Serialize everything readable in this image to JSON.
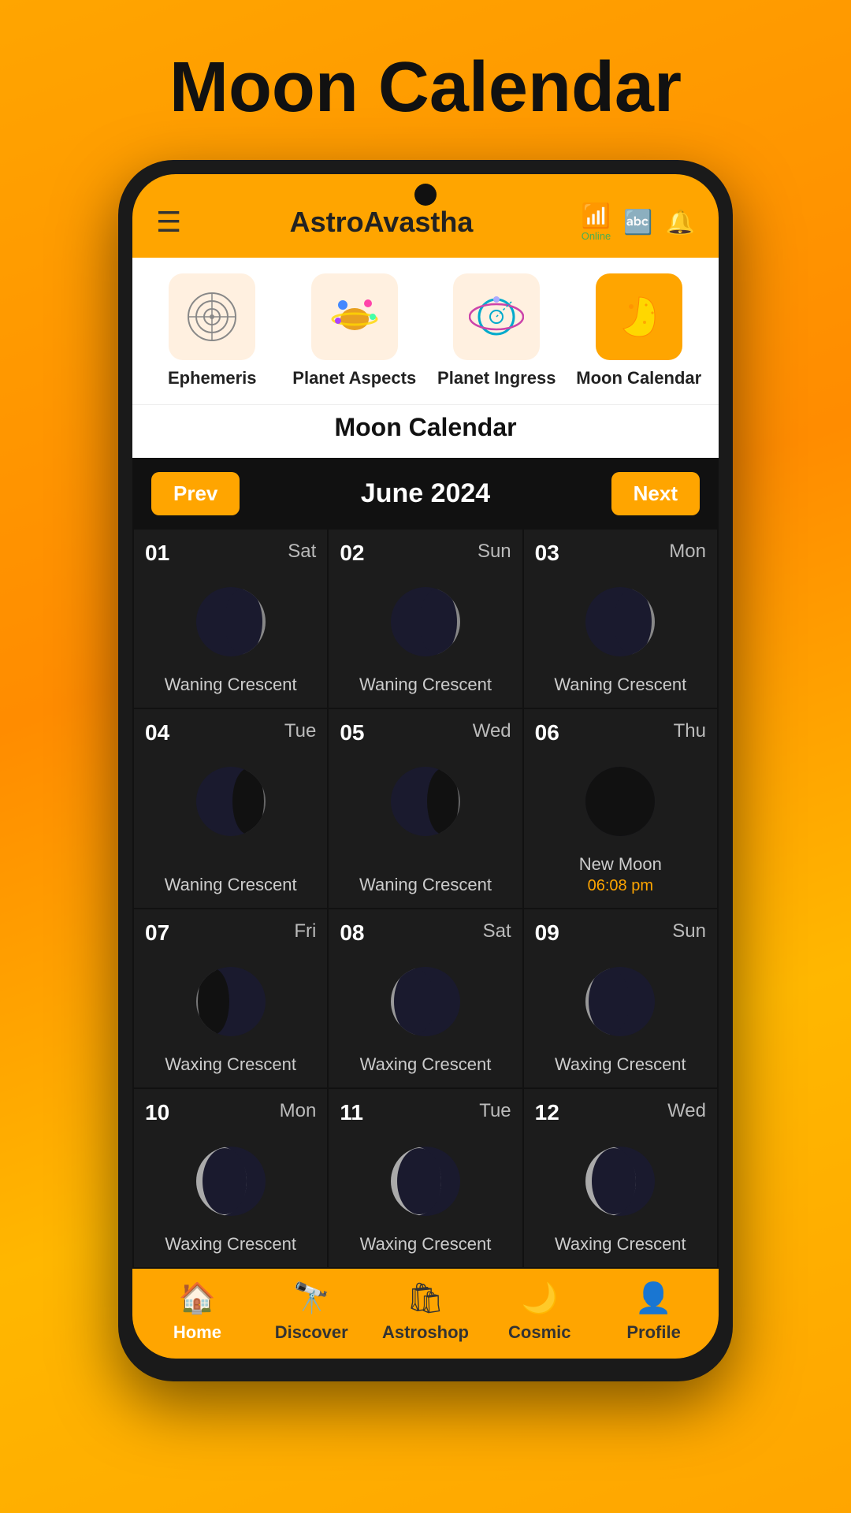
{
  "page": {
    "title": "Moon Calendar"
  },
  "header": {
    "app_name": "AstroAvastha",
    "wifi_status": "Online",
    "wifi_icon": "📶",
    "translate_icon": "A→",
    "bell_icon": "🔔"
  },
  "categories": [
    {
      "id": "ephemeris",
      "label": "Ephemeris",
      "icon": "⚙",
      "active": false
    },
    {
      "id": "planet-aspects",
      "label": "Planet Aspects",
      "icon": "🪐",
      "active": false
    },
    {
      "id": "planet-ingress",
      "label": "Planet Ingress",
      "icon": "🌀",
      "active": false
    },
    {
      "id": "moon-calendar",
      "label": "Moon Calendar",
      "icon": "🌙",
      "active": true
    }
  ],
  "calendar": {
    "title": "Moon Calendar",
    "month": "June 2024",
    "prev_label": "Prev",
    "next_label": "Next",
    "days": [
      {
        "num": "01",
        "day": "Sat",
        "phase": "Waning Crescent",
        "phase_type": "waning-crescent",
        "extra": ""
      },
      {
        "num": "02",
        "day": "Sun",
        "phase": "Waning Crescent",
        "phase_type": "waning-crescent",
        "extra": ""
      },
      {
        "num": "03",
        "day": "Mon",
        "phase": "Waning Crescent",
        "phase_type": "waning-crescent",
        "extra": ""
      },
      {
        "num": "04",
        "day": "Tue",
        "phase": "Waning Crescent",
        "phase_type": "waning-crescent-dark",
        "extra": ""
      },
      {
        "num": "05",
        "day": "Wed",
        "phase": "Waning Crescent",
        "phase_type": "waning-crescent-dark",
        "extra": ""
      },
      {
        "num": "06",
        "day": "Thu",
        "phase": "New Moon",
        "phase_type": "new-moon",
        "extra": "06:08 pm"
      },
      {
        "num": "07",
        "day": "Fri",
        "phase": "Waxing Crescent",
        "phase_type": "waxing-crescent-dark",
        "extra": ""
      },
      {
        "num": "08",
        "day": "Sat",
        "phase": "Waxing Crescent",
        "phase_type": "waxing-crescent",
        "extra": ""
      },
      {
        "num": "09",
        "day": "Sun",
        "phase": "Waxing Crescent",
        "phase_type": "waxing-crescent",
        "extra": ""
      },
      {
        "num": "10",
        "day": "Mon",
        "phase": "Waxing Crescent",
        "phase_type": "waxing-crescent-more",
        "extra": ""
      },
      {
        "num": "11",
        "day": "Tue",
        "phase": "Waxing Crescent",
        "phase_type": "waxing-crescent-more",
        "extra": ""
      },
      {
        "num": "12",
        "day": "Wed",
        "phase": "Waxing Crescent",
        "phase_type": "waxing-crescent-more",
        "extra": ""
      }
    ]
  },
  "bottom_nav": [
    {
      "id": "home",
      "label": "Home",
      "icon": "🏠",
      "active": true
    },
    {
      "id": "discover",
      "label": "Discover",
      "icon": "🔭",
      "active": false
    },
    {
      "id": "astroshop",
      "label": "Astroshop",
      "icon": "🛍",
      "active": false
    },
    {
      "id": "cosmic",
      "label": "Cosmic",
      "icon": "🌙",
      "active": false
    },
    {
      "id": "profile",
      "label": "Profile",
      "icon": "👤",
      "active": false
    }
  ]
}
